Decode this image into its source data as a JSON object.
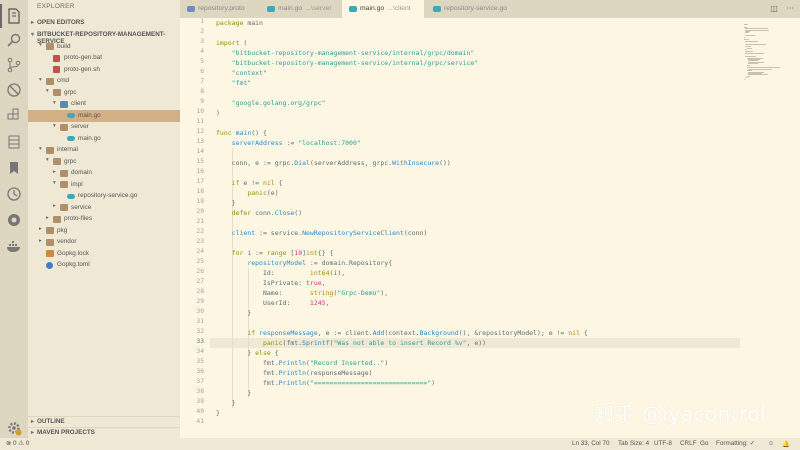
{
  "sidebar": {
    "header": "EXPLORER",
    "open_editors": "OPEN EDITORS",
    "project": "BITBUCKET-REPOSITORY-MANAGEMENT-SERVICE",
    "outline": "OUTLINE",
    "maven": "MAVEN PROJECTS",
    "tree": [
      {
        "name": "build",
        "depth": 1,
        "kind": "folder",
        "arrow": "▾"
      },
      {
        "name": "proto-gen.bat",
        "depth": 2,
        "kind": "file-red"
      },
      {
        "name": "proto-gen.sh",
        "depth": 2,
        "kind": "file-red"
      },
      {
        "name": "cmd",
        "depth": 1,
        "kind": "folder",
        "arrow": "▾"
      },
      {
        "name": "grpc",
        "depth": 2,
        "kind": "folder",
        "arrow": "▾"
      },
      {
        "name": "client",
        "depth": 3,
        "kind": "folder-blue",
        "arrow": "▾"
      },
      {
        "name": "main.go",
        "depth": 4,
        "kind": "file-go",
        "selected": true
      },
      {
        "name": "server",
        "depth": 3,
        "kind": "folder",
        "arrow": "▾"
      },
      {
        "name": "main.go",
        "depth": 4,
        "kind": "file-go"
      },
      {
        "name": "internal",
        "depth": 1,
        "kind": "folder",
        "arrow": "▾"
      },
      {
        "name": "grpc",
        "depth": 2,
        "kind": "folder",
        "arrow": "▾"
      },
      {
        "name": "domain",
        "depth": 3,
        "kind": "folder",
        "arrow": "▸"
      },
      {
        "name": "impl",
        "depth": 3,
        "kind": "folder",
        "arrow": "▾"
      },
      {
        "name": "repository-service.go",
        "depth": 4,
        "kind": "file-go"
      },
      {
        "name": "service",
        "depth": 3,
        "kind": "folder",
        "arrow": "▸"
      },
      {
        "name": "proto-files",
        "depth": 2,
        "kind": "folder",
        "arrow": "▸"
      },
      {
        "name": "pkg",
        "depth": 1,
        "kind": "folder",
        "arrow": "▸"
      },
      {
        "name": "vendor",
        "depth": 1,
        "kind": "folder",
        "arrow": "▸"
      },
      {
        "name": "Gopkg.lock",
        "depth": 1,
        "kind": "file-lock"
      },
      {
        "name": "Gopkg.toml",
        "depth": 1,
        "kind": "file-gear"
      }
    ]
  },
  "tabs": [
    {
      "label": "repository.proto",
      "sub": "",
      "active": false,
      "icon": "proto-file-icon"
    },
    {
      "label": "main.go",
      "sub": "...\\server",
      "active": false,
      "icon": "go-file-icon"
    },
    {
      "label": "main.go",
      "sub": "...\\client",
      "active": true,
      "icon": "go-file-icon"
    },
    {
      "label": "repository-service.go",
      "sub": "",
      "active": false,
      "icon": "go-file-icon"
    }
  ],
  "editor": {
    "current_line": 33,
    "lines": [
      [
        [
          "k",
          "package"
        ],
        [
          "p",
          " main"
        ]
      ],
      [],
      [
        [
          "k",
          "import"
        ],
        [
          "p",
          " ("
        ]
      ],
      [
        [
          "p",
          "    "
        ],
        [
          "s",
          "\"bitbucket-repository-management-service/internal/grpc/domain\""
        ]
      ],
      [
        [
          "p",
          "    "
        ],
        [
          "s",
          "\"bitbucket-repository-management-service/internal/grpc/service\""
        ]
      ],
      [
        [
          "p",
          "    "
        ],
        [
          "s",
          "\"context\""
        ]
      ],
      [
        [
          "p",
          "    "
        ],
        [
          "s",
          "\"fmt\""
        ]
      ],
      [],
      [
        [
          "p",
          "    "
        ],
        [
          "s",
          "\"google.golang.org/grpc\""
        ]
      ],
      [
        [
          "p",
          ")"
        ]
      ],
      [],
      [
        [
          "k",
          "func"
        ],
        [
          "p",
          " "
        ],
        [
          "f",
          "main"
        ],
        [
          "p",
          "() {"
        ]
      ],
      [
        [
          "p",
          "    "
        ],
        [
          "f",
          "serverAddress"
        ],
        [
          "p",
          " := "
        ],
        [
          "s",
          "\"localhost:7000\""
        ]
      ],
      [],
      [
        [
          "p",
          "    conn, e := grpc."
        ],
        [
          "f",
          "Dial"
        ],
        [
          "p",
          "(serverAddress, grpc."
        ],
        [
          "f",
          "WithInsecure"
        ],
        [
          "p",
          "())"
        ]
      ],
      [],
      [
        [
          "p",
          "    "
        ],
        [
          "k",
          "if"
        ],
        [
          "p",
          " e != "
        ],
        [
          "t",
          "nil"
        ],
        [
          "p",
          " {"
        ]
      ],
      [
        [
          "p",
          "        "
        ],
        [
          "k",
          "panic"
        ],
        [
          "p",
          "(e)"
        ]
      ],
      [
        [
          "p",
          "    }"
        ]
      ],
      [
        [
          "p",
          "    "
        ],
        [
          "k",
          "defer"
        ],
        [
          "p",
          " conn."
        ],
        [
          "f",
          "Close"
        ],
        [
          "p",
          "()"
        ]
      ],
      [],
      [
        [
          "p",
          "    "
        ],
        [
          "f",
          "client"
        ],
        [
          "p",
          " := service."
        ],
        [
          "f",
          "NewRepositoryServiceClient"
        ],
        [
          "p",
          "(conn)"
        ]
      ],
      [],
      [
        [
          "p",
          "    "
        ],
        [
          "k",
          "for"
        ],
        [
          "p",
          " i := "
        ],
        [
          "k",
          "range"
        ],
        [
          "p",
          " ["
        ],
        [
          "n",
          "10"
        ],
        [
          "p",
          "]"
        ],
        [
          "t",
          "int"
        ],
        [
          "p",
          "{} {"
        ]
      ],
      [
        [
          "p",
          "        "
        ],
        [
          "f",
          "repositoryModel"
        ],
        [
          "p",
          " := domain.Repository{"
        ]
      ],
      [
        [
          "p",
          "            Id:         "
        ],
        [
          "t",
          "int64"
        ],
        [
          "p",
          "(i),"
        ]
      ],
      [
        [
          "p",
          "            IsPrivate: "
        ],
        [
          "n",
          "true"
        ],
        [
          "p",
          ","
        ]
      ],
      [
        [
          "p",
          "            Name:       "
        ],
        [
          "t",
          "string"
        ],
        [
          "p",
          "("
        ],
        [
          "s",
          "\"Grpc-Demo\""
        ],
        [
          "p",
          "),"
        ]
      ],
      [
        [
          "p",
          "            UserId:     "
        ],
        [
          "n",
          "1245"
        ],
        [
          "p",
          ","
        ]
      ],
      [
        [
          "p",
          "        }"
        ]
      ],
      [],
      [
        [
          "p",
          "        "
        ],
        [
          "k",
          "if"
        ],
        [
          "p",
          " "
        ],
        [
          "f",
          "responseMessage"
        ],
        [
          "p",
          ", e := client."
        ],
        [
          "f",
          "Add"
        ],
        [
          "p",
          "(context."
        ],
        [
          "f",
          "Background"
        ],
        [
          "p",
          "(), &repositoryModel); e != "
        ],
        [
          "t",
          "nil"
        ],
        [
          "p",
          " {"
        ]
      ],
      [
        [
          "p",
          "            "
        ],
        [
          "k",
          "panic"
        ],
        [
          "p",
          "(fmt."
        ],
        [
          "f",
          "Sprintf"
        ],
        [
          "p",
          "("
        ],
        [
          "s",
          "\"Was not able to insert Record %v\""
        ],
        [
          "p",
          ", e))"
        ]
      ],
      [
        [
          "p",
          "        } "
        ],
        [
          "k",
          "else"
        ],
        [
          "p",
          " {"
        ]
      ],
      [
        [
          "p",
          "            fmt."
        ],
        [
          "f",
          "Println"
        ],
        [
          "p",
          "("
        ],
        [
          "s",
          "\"Record Inserted..\""
        ],
        [
          "p",
          ")"
        ]
      ],
      [
        [
          "p",
          "            fmt."
        ],
        [
          "f",
          "Println"
        ],
        [
          "p",
          "(responseMessage)"
        ]
      ],
      [
        [
          "p",
          "            fmt."
        ],
        [
          "f",
          "Println"
        ],
        [
          "p",
          "("
        ],
        [
          "s",
          "\"=============================\""
        ],
        [
          "p",
          ")"
        ]
      ],
      [
        [
          "p",
          "        }"
        ]
      ],
      [
        [
          "p",
          "    }"
        ]
      ],
      [
        [
          "p",
          "}"
        ]
      ],
      []
    ]
  },
  "watermark": "知乎 @iyacontrol",
  "status": {
    "errors": "0",
    "warnings": "0",
    "position": "Ln 33, Col 70",
    "tab_size": "Tab Size: 4",
    "encoding": "UTF-8",
    "eol": "CRLF",
    "language": "Go",
    "formatting": "Formatting: ✓"
  },
  "colors": {
    "keyword": "#859900",
    "string": "#2aa198",
    "function": "#268bd2",
    "type": "#b58900",
    "number": "#d33682",
    "background": "#fdf6e3"
  }
}
